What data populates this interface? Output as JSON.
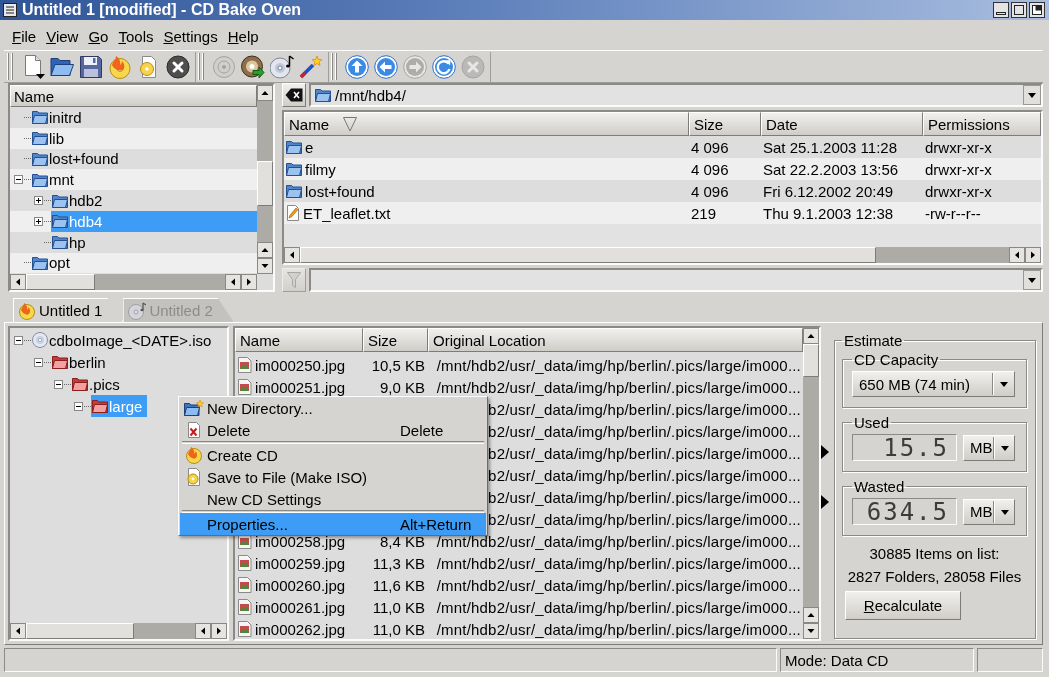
{
  "window": {
    "title": "Untitled 1 [modified] - CD Bake Oven"
  },
  "menu_bar": [
    "File",
    "View",
    "Go",
    "Tools",
    "Settings",
    "Help"
  ],
  "toolbar": [
    {
      "buttons": [
        {
          "disabled": false
        },
        {
          "disabled": false
        },
        {
          "disabled": false
        },
        {
          "disabled": false
        },
        {
          "disabled": false
        },
        {
          "disabled": false
        }
      ]
    },
    {
      "buttons": [
        {
          "disabled": true
        },
        {
          "disabled": false
        },
        {
          "disabled": false
        },
        {
          "disabled": false
        }
      ]
    },
    {
      "buttons": [
        {
          "disabled": false
        },
        {
          "disabled": false
        },
        {
          "disabled": true
        },
        {
          "disabled": false
        },
        {
          "disabled": true
        }
      ]
    }
  ],
  "folder_tree": {
    "header": "Name",
    "items": [
      {
        "label": "initrd",
        "selected": false
      },
      {
        "label": "lib",
        "selected": false
      },
      {
        "label": "lost+found",
        "selected": false
      },
      {
        "label": "mnt",
        "selected": false,
        "expanded": true,
        "children": [
          {
            "label": "hdb2",
            "selected": false,
            "expanded": false
          },
          {
            "label": "hdb4",
            "selected": true,
            "expanded": false
          },
          {
            "label": "hp",
            "selected": false
          }
        ]
      },
      {
        "label": "opt",
        "selected": false
      }
    ]
  },
  "location_bar": {
    "value": "/mnt/hdb4/"
  },
  "file_table": {
    "columns": [
      {
        "label": "Name",
        "sorted": true
      },
      {
        "label": "Size",
        "sorted": false
      },
      {
        "label": "Date",
        "sorted": false
      },
      {
        "label": "Permissions",
        "sorted": false
      }
    ],
    "rows": [
      {
        "kind": "folder",
        "name": "e",
        "size": "4 096",
        "date": "Sat 25.1.2003 11:28",
        "permissions": "drwxr-xr-x"
      },
      {
        "kind": "folder",
        "name": "filmy",
        "size": "4 096",
        "date": "Sat 22.2.2003 13:56",
        "permissions": "drwxr-xr-x"
      },
      {
        "kind": "folder",
        "name": "lost+found",
        "size": "4 096",
        "date": "Fri 6.12.2002 20:49",
        "permissions": "drwxr-xr-x"
      },
      {
        "kind": "text",
        "name": "ET_leaflet.txt",
        "size": "219",
        "date": "Thu 9.1.2003 12:38",
        "permissions": "-rw-r--r--"
      }
    ]
  },
  "tabs": [
    {
      "label": "Untitled 1",
      "selected": true
    },
    {
      "label": "Untitled 2",
      "selected": false
    }
  ],
  "cd_tree": {
    "items": [
      {
        "kind": "disc",
        "label": "cdboImage_<DATE>.iso",
        "selected": false,
        "expanded": true,
        "children": [
          {
            "kind": "folder",
            "label": "berlin",
            "selected": false,
            "expanded": true,
            "children": [
              {
                "kind": "folder",
                "label": ".pics",
                "selected": false,
                "expanded": true,
                "children": [
                  {
                    "kind": "folder",
                    "label": "large",
                    "selected": true,
                    "expanded": true
                  }
                ]
              }
            ]
          }
        ]
      }
    ]
  },
  "cd_contents": {
    "columns": [
      "Name",
      "Size",
      "Original Location"
    ],
    "rows": [
      {
        "name": "im000250.jpg",
        "size": "10,5 KB",
        "location": "/mnt/hdb2/usr/_data/img/hp/berlin/.pics/large/im000..."
      },
      {
        "name": "im000251.jpg",
        "size": "9,0 KB",
        "location": "/mnt/hdb2/usr/_data/img/hp/berlin/.pics/large/im000..."
      },
      {
        "location": "b2/usr/_data/img/hp/berlin/.pics/large/im000..."
      },
      {
        "location": "b2/usr/_data/img/hp/berlin/.pics/large/im000..."
      },
      {
        "location": "b2/usr/_data/img/hp/berlin/.pics/large/im000..."
      },
      {
        "location": "b2/usr/_data/img/hp/berlin/.pics/large/im000..."
      },
      {
        "location": "b2/usr/_data/img/hp/berlin/.pics/large/im000..."
      },
      {
        "location": "b2/usr/_data/img/hp/berlin/.pics/large/im000..."
      },
      {
        "name": "im000258.jpg",
        "size": "8,4 KB",
        "location": "/mnt/hdb2/usr/_data/img/hp/berlin/.pics/large/im000..."
      },
      {
        "name": "im000259.jpg",
        "size": "11,3 KB",
        "location": "/mnt/hdb2/usr/_data/img/hp/berlin/.pics/large/im000..."
      },
      {
        "name": "im000260.jpg",
        "size": "11,6 KB",
        "location": "/mnt/hdb2/usr/_data/img/hp/berlin/.pics/large/im000..."
      },
      {
        "name": "im000261.jpg",
        "size": "11,0 KB",
        "location": "/mnt/hdb2/usr/_data/img/hp/berlin/.pics/large/im000..."
      },
      {
        "name": "im000262.jpg",
        "size": "11,0 KB",
        "location": "/mnt/hdb2/usr/_data/img/hp/berlin/.pics/large/im000..."
      }
    ]
  },
  "context_menu": {
    "items": [
      {
        "kind": "item",
        "label": "New Directory...",
        "selected": false
      },
      {
        "kind": "item",
        "label": "Delete",
        "shortcut": "Delete",
        "selected": false
      },
      {
        "kind": "separator"
      },
      {
        "kind": "item",
        "label": "Create CD",
        "selected": false
      },
      {
        "kind": "item",
        "label": "Save to File (Make ISO)",
        "selected": false
      },
      {
        "kind": "item",
        "label": "New CD Settings",
        "selected": false
      },
      {
        "kind": "separator"
      },
      {
        "kind": "item",
        "label": "Properties...",
        "shortcut": "Alt+Return",
        "selected": true
      }
    ]
  },
  "estimate": {
    "title": "Estimate",
    "capacity": {
      "title": "CD Capacity",
      "value": "650 MB (74 min)"
    },
    "used": {
      "title": "Used",
      "value": "15.5",
      "unit": "MB"
    },
    "wasted": {
      "title": "Wasted",
      "value": "634.5",
      "unit": "MB"
    },
    "summary": [
      "30885 Items on list:",
      "2827 Folders, 28058 Files"
    ],
    "button": "Recalculate"
  },
  "status_bar": {
    "mode": "Mode: Data CD"
  }
}
